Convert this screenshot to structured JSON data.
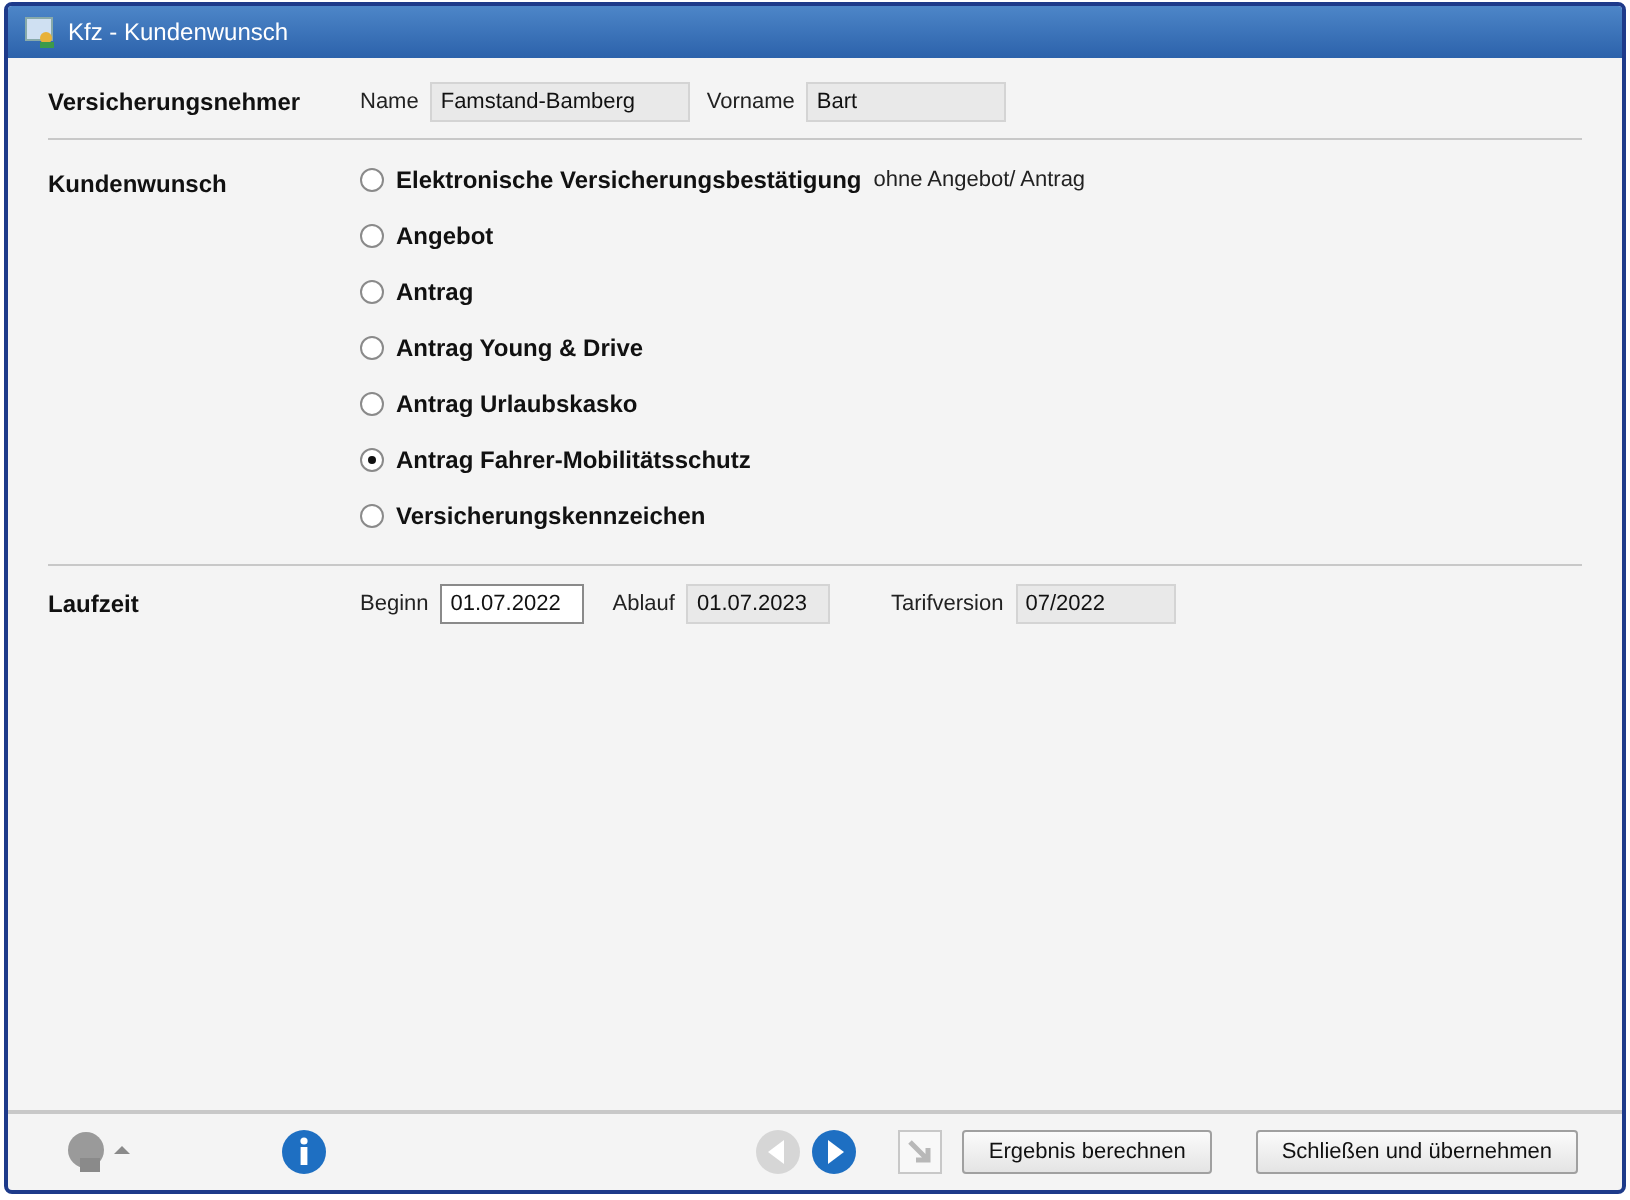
{
  "window": {
    "title": "Kfz - Kundenwunsch"
  },
  "policyholder": {
    "label": "Versicherungsnehmer",
    "fields": [
      {
        "label": "Name",
        "value": "Famstand-Bamberg",
        "disabled": true
      },
      {
        "label": "Vorname",
        "value": "Bart",
        "disabled": true
      }
    ]
  },
  "request": {
    "label": "Kundenwunsch",
    "options": [
      {
        "label": "Elektronische Versicherungsbestätigung",
        "note": "ohne Angebot/ Antrag",
        "selected": false
      },
      {
        "label": "Angebot",
        "selected": false
      },
      {
        "label": "Antrag",
        "selected": false
      },
      {
        "label": "Antrag Young & Drive",
        "selected": false
      },
      {
        "label": "Antrag Urlaubskasko",
        "selected": false
      },
      {
        "label": "Antrag Fahrer-Mobilitätsschutz",
        "selected": true
      },
      {
        "label": "Versicherungskennzeichen",
        "selected": false
      }
    ]
  },
  "term": {
    "label": "Laufzeit",
    "fields": [
      {
        "label": "Beginn",
        "value": "01.07.2022",
        "disabled": false
      },
      {
        "label": "Ablauf",
        "value": "01.07.2023",
        "disabled": true
      },
      {
        "label": "Tarifversion",
        "value": "07/2022",
        "disabled": true
      }
    ]
  },
  "footer": {
    "back_disabled": true,
    "forward_disabled": false,
    "jump_disabled": true,
    "buttons": [
      "Ergebnis berechnen",
      "Schließen und übernehmen"
    ]
  }
}
